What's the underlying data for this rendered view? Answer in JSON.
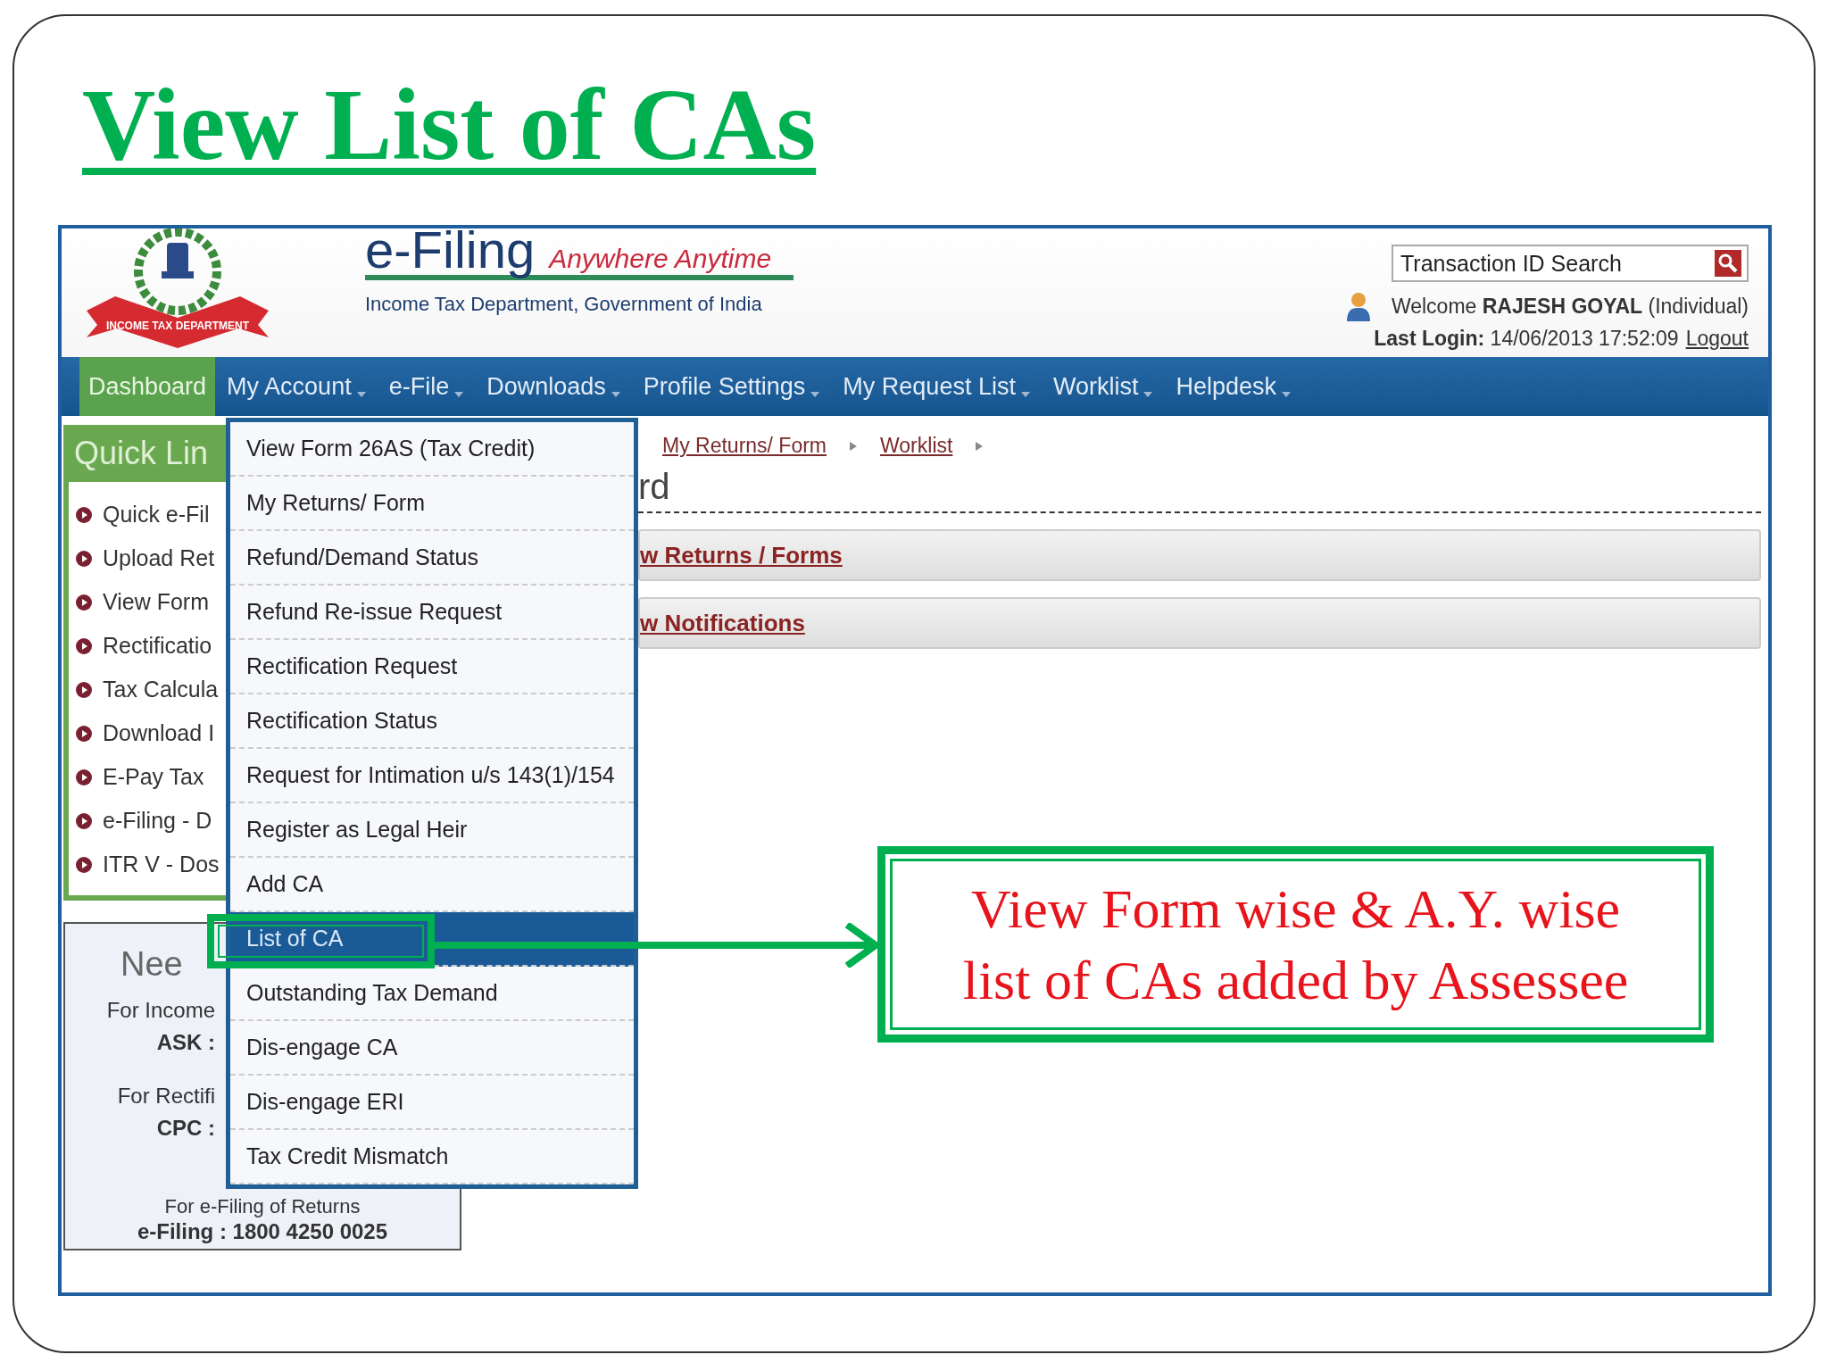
{
  "slide_title": "View List of CAs",
  "header": {
    "logo_text": "INCOME TAX DEPARTMENT",
    "brand": "e-Filing",
    "tagline": "Anywhere Anytime",
    "department": "Income Tax Department, Government of India",
    "search": {
      "placeholder": "Transaction ID Search"
    },
    "welcome": "Welcome **RAJESH GOYAL** (Individual)",
    "last_login": "**Last Login:** 14/06/2013 17:52:09",
    "logout": "Logout"
  },
  "nav": [
    {
      "label": "Dashboard",
      "selected": true,
      "caret": false
    },
    {
      "label": "My Account",
      "selected": false,
      "caret": true
    },
    {
      "label": "e-File",
      "selected": false,
      "caret": true
    },
    {
      "label": "Downloads",
      "selected": false,
      "caret": true
    },
    {
      "label": "Profile Settings",
      "selected": false,
      "caret": true
    },
    {
      "label": "My Request List",
      "selected": false,
      "caret": true
    },
    {
      "label": "Worklist",
      "selected": false,
      "caret": true
    },
    {
      "label": "Helpdesk",
      "selected": false,
      "caret": true
    }
  ],
  "quick_links": {
    "title": "Quick Lin",
    "items": [
      "Quick e-Fil",
      "Upload Ret",
      "View Form",
      "Rectificatio",
      "Tax Calcula",
      "Download I",
      "E-Pay Tax",
      "e-Filing - D",
      "ITR V - Dos"
    ]
  },
  "help": {
    "title": "Nee",
    "lines": [
      {
        "kind": "label",
        "text": "For Income"
      },
      {
        "kind": "bold",
        "text": "ASK :"
      },
      {
        "kind": "label",
        "text": "For Rectifi"
      },
      {
        "kind": "bold",
        "text": "CPC :"
      }
    ],
    "footer_label": "For e-Filing of Returns",
    "footer_number": "e-Filing : 1800 4250 0025"
  },
  "breadcrumbs": [
    "My Returns/ Form",
    "Worklist"
  ],
  "heading": "rd",
  "panels": [
    "w Returns / Forms",
    "w Notifications"
  ],
  "menu": [
    {
      "label": "View Form 26AS (Tax Credit)",
      "selected": false
    },
    {
      "label": "My Returns/ Form",
      "selected": false
    },
    {
      "label": "Refund/Demand Status",
      "selected": false
    },
    {
      "label": "Refund Re-issue Request",
      "selected": false
    },
    {
      "label": "Rectification Request",
      "selected": false
    },
    {
      "label": "Rectification Status",
      "selected": false
    },
    {
      "label": "Request for Intimation u/s 143(1)/154",
      "selected": false
    },
    {
      "label": "Register as Legal Heir",
      "selected": false
    },
    {
      "label": "Add CA",
      "selected": false
    },
    {
      "label": "List of CA",
      "selected": true
    },
    {
      "label": "Outstanding Tax Demand",
      "selected": false
    },
    {
      "label": "Dis-engage CA",
      "selected": false
    },
    {
      "label": "Dis-engage ERI",
      "selected": false
    },
    {
      "label": "Tax Credit Mismatch",
      "selected": false
    }
  ],
  "callout": {
    "lines": [
      "View Form wise & A.Y. wise",
      "list of CAs added by Assessee"
    ]
  }
}
